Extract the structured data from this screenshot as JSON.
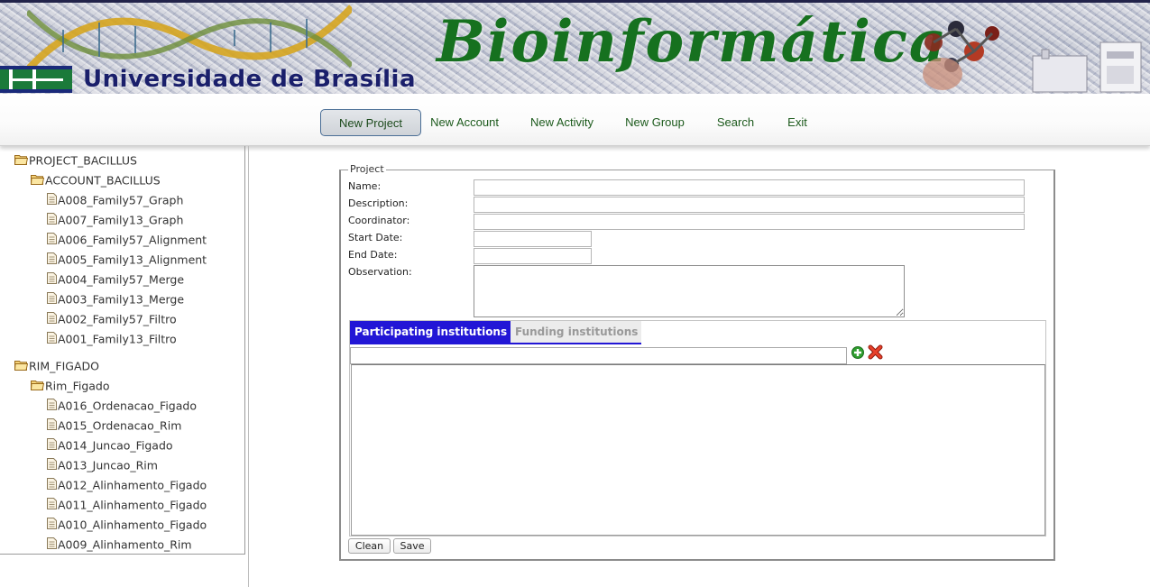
{
  "banner": {
    "university": "Universidade de Brasília",
    "title": "Bioinformática"
  },
  "nav": {
    "items": [
      {
        "label": "New Project",
        "active": true
      },
      {
        "label": "New Account"
      },
      {
        "label": "New Activity"
      },
      {
        "label": "New Group"
      },
      {
        "label": "Search"
      },
      {
        "label": "Exit"
      }
    ]
  },
  "tree": {
    "projects": [
      {
        "name": "PROJECT_BACILLUS",
        "account": "ACCOUNT_BACILLUS",
        "activities": [
          "A008_Family57_Graph",
          "A007_Family13_Graph",
          "A006_Family57_Alignment",
          "A005_Family13_Alignment",
          "A004_Family57_Merge",
          "A003_Family13_Merge",
          "A002_Family57_Filtro",
          "A001_Family13_Filtro"
        ]
      },
      {
        "name": "RIM_FIGADO",
        "account": "Rim_Figado",
        "activities": [
          "A016_Ordenacao_Figado",
          "A015_Ordenacao_Rim",
          "A014_Juncao_Figado",
          "A013_Juncao_Rim",
          "A012_Alinhamento_Figado",
          "A011_Alinhamento_Figado",
          "A010_Alinhamento_Figado",
          "A009_Alinhamento_Rim"
        ]
      }
    ]
  },
  "form": {
    "legend": "Project",
    "name_label": "Name:",
    "name_value": "",
    "description_label": "Description:",
    "description_value": "",
    "coordinator_label": "Coordinator:",
    "coordinator_value": "",
    "start_date_label": "Start Date:",
    "start_date_value": "",
    "end_date_label": "End Date:",
    "end_date_value": "",
    "observation_label": "Observation:",
    "observation_value": "",
    "tabs": {
      "participating": "Participating institutions",
      "funding": "Funding institutions"
    },
    "institution_value": "",
    "clean_label": "Clean",
    "save_label": "Save"
  },
  "colors": {
    "title_green": "#16711f",
    "university_blue": "#1a1f6b",
    "tab_active": "#2216d6",
    "nav_text": "#1c5a1c"
  },
  "icons": {
    "tree_folder": "folder-open-icon",
    "tree_activity": "document-icon",
    "add": "plus-circle-icon",
    "remove": "red-x-icon"
  }
}
